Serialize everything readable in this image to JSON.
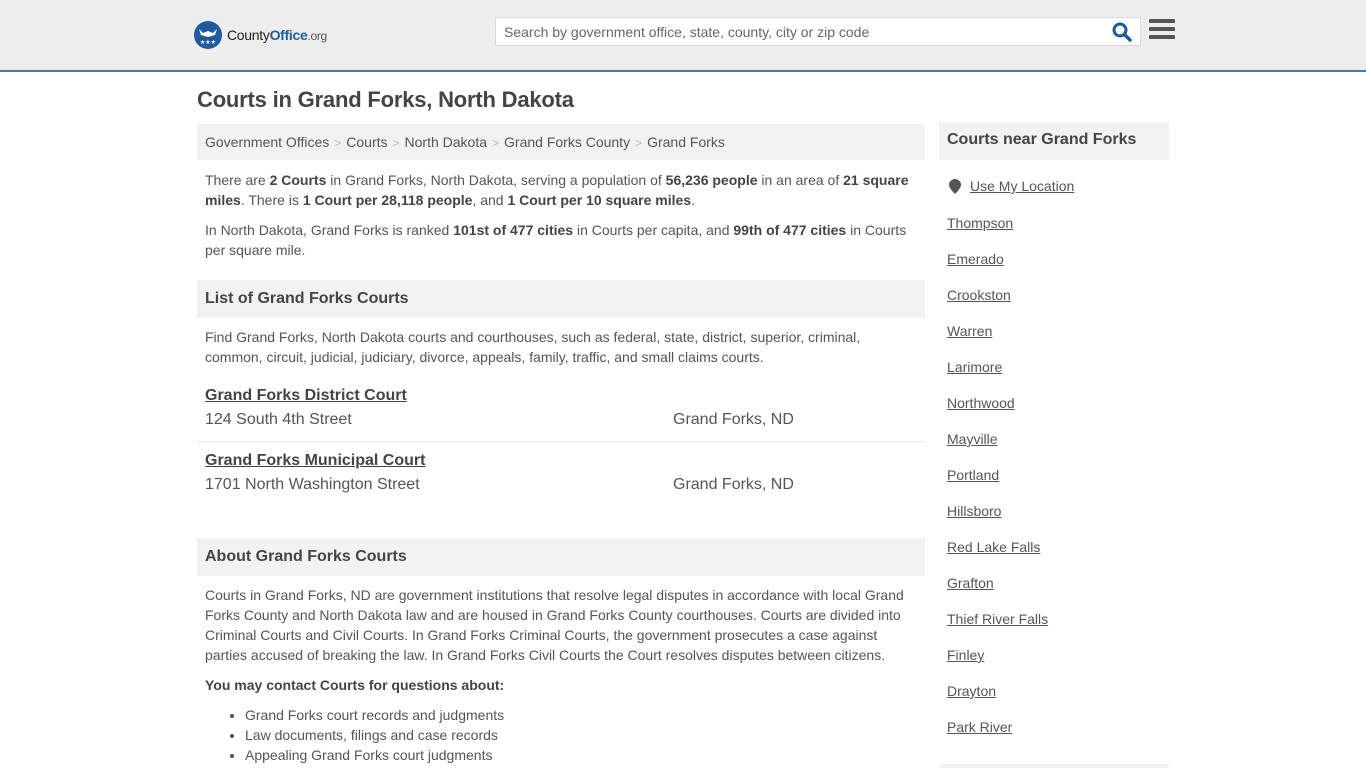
{
  "header": {
    "logo": {
      "name": "County",
      "office": "Office",
      "tld": ".org"
    },
    "search": {
      "placeholder": "Search by government office, state, county, city or zip code",
      "value": ""
    },
    "search_icon": "search-icon",
    "menu_icon": "hamburger-menu-icon"
  },
  "page": {
    "title": "Courts in Grand Forks, North Dakota"
  },
  "breadcrumb": [
    "Government Offices",
    "Courts",
    "North Dakota",
    "Grand Forks County",
    "Grand Forks"
  ],
  "summary": {
    "p1": {
      "t1": "There are ",
      "b1": "2 Courts",
      "t2": " in Grand Forks, North Dakota, serving a population of ",
      "b2": "56,236 people",
      "t3": " in an area of ",
      "b3": "21 square miles",
      "t4": ". There is ",
      "b4": "1 Court per 28,118 people",
      "t5": ", and ",
      "b5": "1 Court per 10 square miles",
      "t6": "."
    },
    "p2": {
      "t1": "In North Dakota, Grand Forks is ranked ",
      "b1": "101st of 477 cities",
      "t2": " in Courts per capita, and ",
      "b2": "99th of 477 cities",
      "t3": " in Courts per square mile."
    }
  },
  "list_section": {
    "title": "List of Grand Forks Courts",
    "intro": "Find Grand Forks, North Dakota courts and courthouses, such as federal, state, district, superior, criminal, common, circuit, judicial, judiciary, divorce, appeals, family, traffic, and small claims courts.",
    "courts": [
      {
        "name": "Grand Forks District Court",
        "address": "124 South 4th Street",
        "city": "Grand Forks, ND"
      },
      {
        "name": "Grand Forks Municipal Court",
        "address": "1701 North Washington Street",
        "city": "Grand Forks, ND"
      }
    ]
  },
  "about_section": {
    "title": "About Grand Forks Courts",
    "body": "Courts in Grand Forks, ND are government institutions that resolve legal disputes in accordance with local Grand Forks County and North Dakota law and are housed in Grand Forks County courthouses. Courts are divided into Criminal Courts and Civil Courts. In Grand Forks Criminal Courts, the government prosecutes a case against parties accused of breaking the law. In Grand Forks Civil Courts the Court resolves disputes between citizens.",
    "contact_title": "You may contact Courts for questions about:",
    "contact_items": [
      "Grand Forks court records and judgments",
      "Law documents, filings and case records",
      "Appealing Grand Forks court judgments"
    ]
  },
  "sidebar": {
    "title": "Courts near Grand Forks",
    "use_location": "Use My Location",
    "location_icon": "map-marker-icon",
    "cities": [
      "Thompson",
      "Emerado",
      "Crookston",
      "Warren",
      "Larimore",
      "Northwood",
      "Mayville",
      "Portland",
      "Hillsboro",
      "Red Lake Falls",
      "Grafton",
      "Thief River Falls",
      "Finley",
      "Drayton",
      "Park River"
    ]
  },
  "colors": {
    "brand_blue": "#1f5b9b",
    "header_border": "#3d7fb3",
    "header_bg": "#ededed",
    "panel_bg": "#f2f2f2",
    "text": "#555555"
  }
}
